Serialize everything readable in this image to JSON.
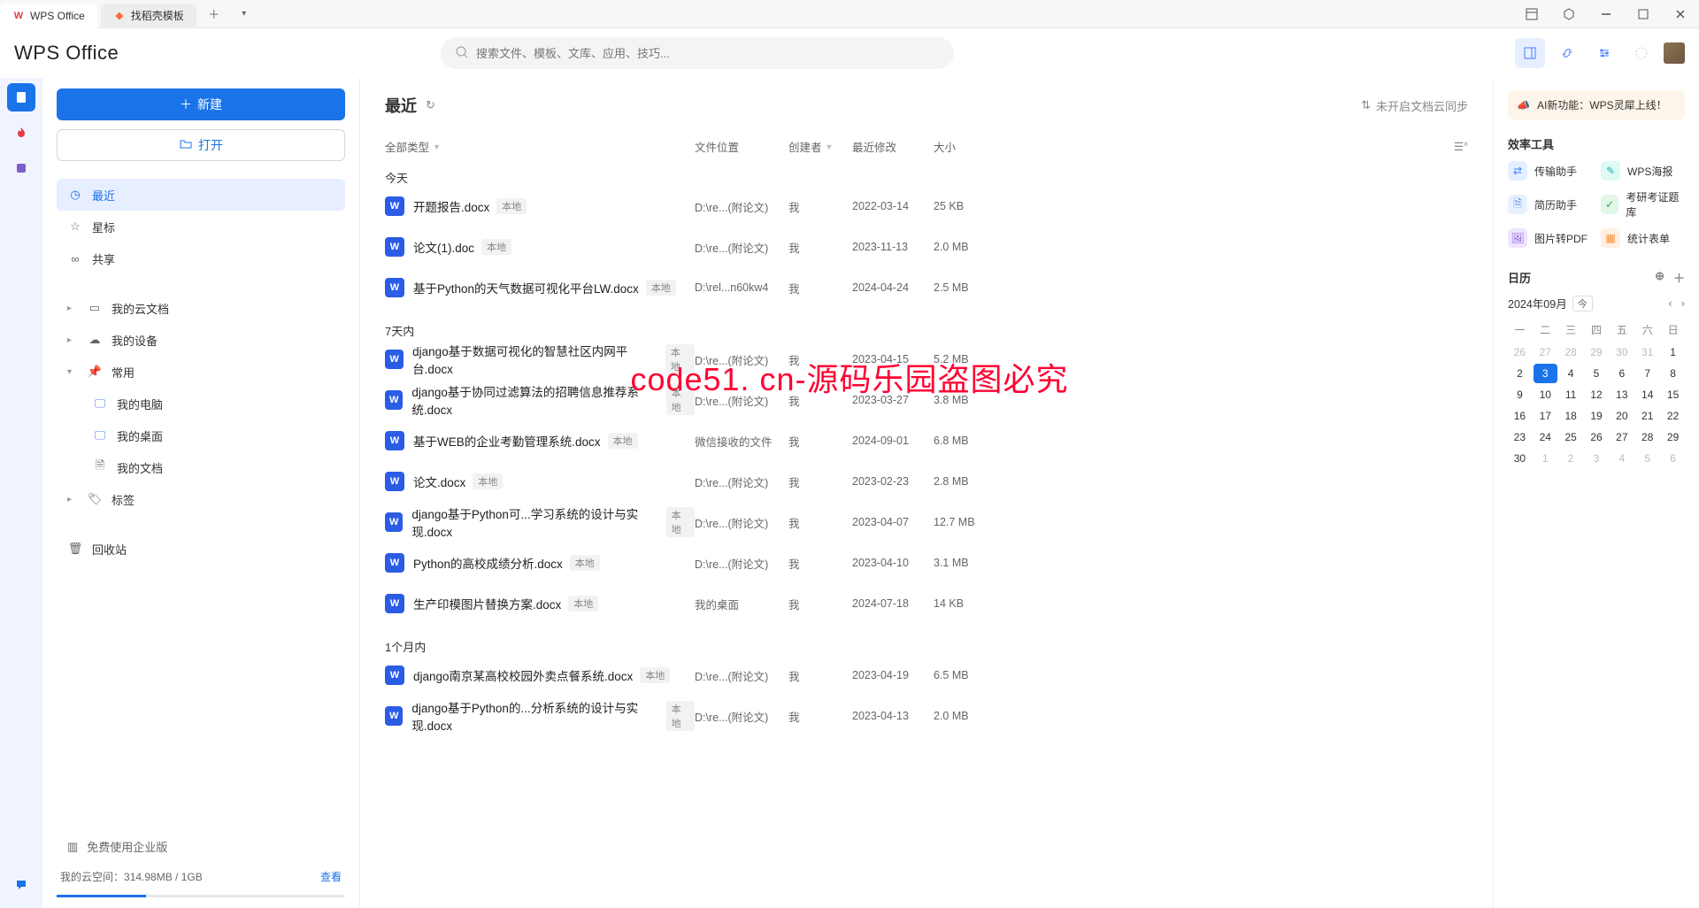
{
  "titlebar": {
    "tabs": [
      {
        "label": "WPS Office",
        "icon": "W"
      },
      {
        "label": "找稻壳模板",
        "icon": "稻"
      }
    ]
  },
  "brand": "WPS Office",
  "search": {
    "placeholder": "搜索文件、模板、文库、应用、技巧..."
  },
  "sidebar": {
    "new_btn": "新建",
    "open_btn": "打开",
    "nav": {
      "recent": "最近",
      "star": "星标",
      "share": "共享",
      "cloud": "我的云文档",
      "device": "我的设备",
      "common": "常用",
      "pc": "我的电脑",
      "desktop": "我的桌面",
      "docs": "我的文档",
      "tags": "标签",
      "trash": "回收站"
    },
    "enterprise": "免费使用企业版",
    "storage_label": "我的云空间：",
    "storage_used": "314.98MB / 1GB",
    "storage_link": "查看"
  },
  "content": {
    "title": "最近",
    "sync_status": "未开启文档云同步",
    "filters": {
      "type": "全部类型",
      "location": "文件位置",
      "creator": "创建者",
      "modified": "最近修改",
      "size": "大小"
    },
    "sections": {
      "today": "今天",
      "week": "7天内",
      "month": "1个月内"
    },
    "tag_local": "本地",
    "creator_me": "我",
    "files_today": [
      {
        "name": "开题报告.docx",
        "loc": "D:\\re...(附论文)",
        "date": "2022-03-14",
        "size": "25 KB"
      },
      {
        "name": "论文(1).doc",
        "loc": "D:\\re...(附论文)",
        "date": "2023-11-13",
        "size": "2.0 MB"
      },
      {
        "name": "基于Python的天气数据可视化平台LW.docx",
        "loc": "D:\\rel...n60kw4",
        "date": "2024-04-24",
        "size": "2.5 MB"
      }
    ],
    "files_week": [
      {
        "name": "django基于数据可视化的智慧社区内网平台.docx",
        "loc": "D:\\re...(附论文)",
        "date": "2023-04-15",
        "size": "5.2 MB"
      },
      {
        "name": "django基于协同过滤算法的招聘信息推荐系统.docx",
        "loc": "D:\\re...(附论文)",
        "date": "2023-03-27",
        "size": "3.8 MB"
      },
      {
        "name": "基于WEB的企业考勤管理系统.docx",
        "loc": "微信接收的文件",
        "date": "2024-09-01",
        "size": "6.8 MB"
      },
      {
        "name": "论文.docx",
        "loc": "D:\\re...(附论文)",
        "date": "2023-02-23",
        "size": "2.8 MB"
      },
      {
        "name": "django基于Python可...学习系统的设计与实现.docx",
        "loc": "D:\\re...(附论文)",
        "date": "2023-04-07",
        "size": "12.7 MB"
      },
      {
        "name": "Python的高校成绩分析.docx",
        "loc": "D:\\re...(附论文)",
        "date": "2023-04-10",
        "size": "3.1 MB"
      },
      {
        "name": "生产印模图片替换方案.docx",
        "loc": "我的桌面",
        "date": "2024-07-18",
        "size": "14 KB"
      }
    ],
    "files_month": [
      {
        "name": "django南京某高校校园外卖点餐系统.docx",
        "loc": "D:\\re...(附论文)",
        "date": "2023-04-19",
        "size": "6.5 MB"
      },
      {
        "name": "django基于Python的...分析系统的设计与实现.docx",
        "loc": "D:\\re...(附论文)",
        "date": "2023-04-13",
        "size": "2.0 MB"
      }
    ]
  },
  "right": {
    "ai_banner": "AI新功能：WPS灵犀上线！",
    "tools_title": "效率工具",
    "tools": [
      "传输助手",
      "WPS海报",
      "简历助手",
      "考研考证题库",
      "图片转PDF",
      "统计表单"
    ],
    "calendar_title": "日历",
    "calendar_month": "2024年09月",
    "today_label": "今",
    "weekdays": [
      "一",
      "二",
      "三",
      "四",
      "五",
      "六",
      "日"
    ],
    "days": [
      {
        "d": "26",
        "dim": true
      },
      {
        "d": "27",
        "dim": true
      },
      {
        "d": "28",
        "dim": true
      },
      {
        "d": "29",
        "dim": true
      },
      {
        "d": "30",
        "dim": true
      },
      {
        "d": "31",
        "dim": true
      },
      {
        "d": "1"
      },
      {
        "d": "2"
      },
      {
        "d": "3",
        "today": true
      },
      {
        "d": "4"
      },
      {
        "d": "5"
      },
      {
        "d": "6"
      },
      {
        "d": "7"
      },
      {
        "d": "8"
      },
      {
        "d": "9"
      },
      {
        "d": "10"
      },
      {
        "d": "11"
      },
      {
        "d": "12"
      },
      {
        "d": "13"
      },
      {
        "d": "14"
      },
      {
        "d": "15"
      },
      {
        "d": "16"
      },
      {
        "d": "17"
      },
      {
        "d": "18"
      },
      {
        "d": "19"
      },
      {
        "d": "20"
      },
      {
        "d": "21"
      },
      {
        "d": "22"
      },
      {
        "d": "23"
      },
      {
        "d": "24"
      },
      {
        "d": "25"
      },
      {
        "d": "26"
      },
      {
        "d": "27"
      },
      {
        "d": "28"
      },
      {
        "d": "29"
      },
      {
        "d": "30"
      },
      {
        "d": "1",
        "dim": true
      },
      {
        "d": "2",
        "dim": true
      },
      {
        "d": "3",
        "dim": true
      },
      {
        "d": "4",
        "dim": true
      },
      {
        "d": "5",
        "dim": true
      },
      {
        "d": "6",
        "dim": true
      }
    ]
  },
  "watermark": "code51. cn-源码乐园盗图必究"
}
